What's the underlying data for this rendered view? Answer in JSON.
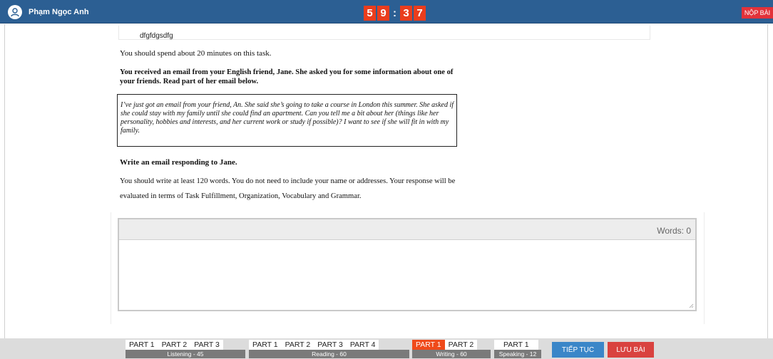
{
  "header": {
    "user_name": "Phạm Ngọc Anh",
    "timer": {
      "d1": "5",
      "d2": "9",
      "sep": ":",
      "d3": "3",
      "d4": "7"
    },
    "submit_label": "NỘP BÀI"
  },
  "question": {
    "title": "dfgfdgsdfg",
    "instruction": "You should spend about 20 minutes on this task.",
    "intro": "You received an email from your English friend, Jane. She asked you for some information about one of your friends. Read part of her email below.",
    "email": "I’ve just got an email from your friend, An. She said she’s going to take a course in London this summer. She asked if she could stay with my family until she could find an apartment. Can you tell me a bit about her (things like her personality, hobbies and interests, and her current work or study if possible)? I want to see if she will fit in with my family.",
    "task": "Write an email responding to Jane.",
    "note": "You should write at least 120 words. You do not need to include your name or addresses. Your response will be evaluated in terms of Task Fulfillment, Organization, Vocabulary and Grammar."
  },
  "answer": {
    "word_count_label": "Words: 0",
    "value": ""
  },
  "footer": {
    "groups": [
      {
        "caption": "Listening - 45",
        "parts": [
          "PART 1",
          "PART 2",
          "PART 3"
        ],
        "active_index": -1
      },
      {
        "caption": "Reading - 60",
        "parts": [
          "PART 1",
          "PART 2",
          "PART 3",
          "PART 4"
        ],
        "active_index": -1
      },
      {
        "caption": "Writing - 60",
        "parts": [
          "PART 1",
          "PART 2"
        ],
        "active_index": 0
      },
      {
        "caption": "Speaking - 12",
        "parts": [
          "PART 1"
        ],
        "active_index": -1
      }
    ],
    "next_label": "TIẾP TỤC",
    "save_label": "LƯU BÀI"
  },
  "colors": {
    "header_bg": "#2c5f93",
    "timer_digit": "#ea3d1d",
    "submit": "#e2323a",
    "active_part": "#ef4a1a",
    "next_button": "#3a86c8",
    "save_button": "#d9423f"
  },
  "icons": {
    "avatar": "user-icon",
    "resize": "resize-grip-icon"
  }
}
